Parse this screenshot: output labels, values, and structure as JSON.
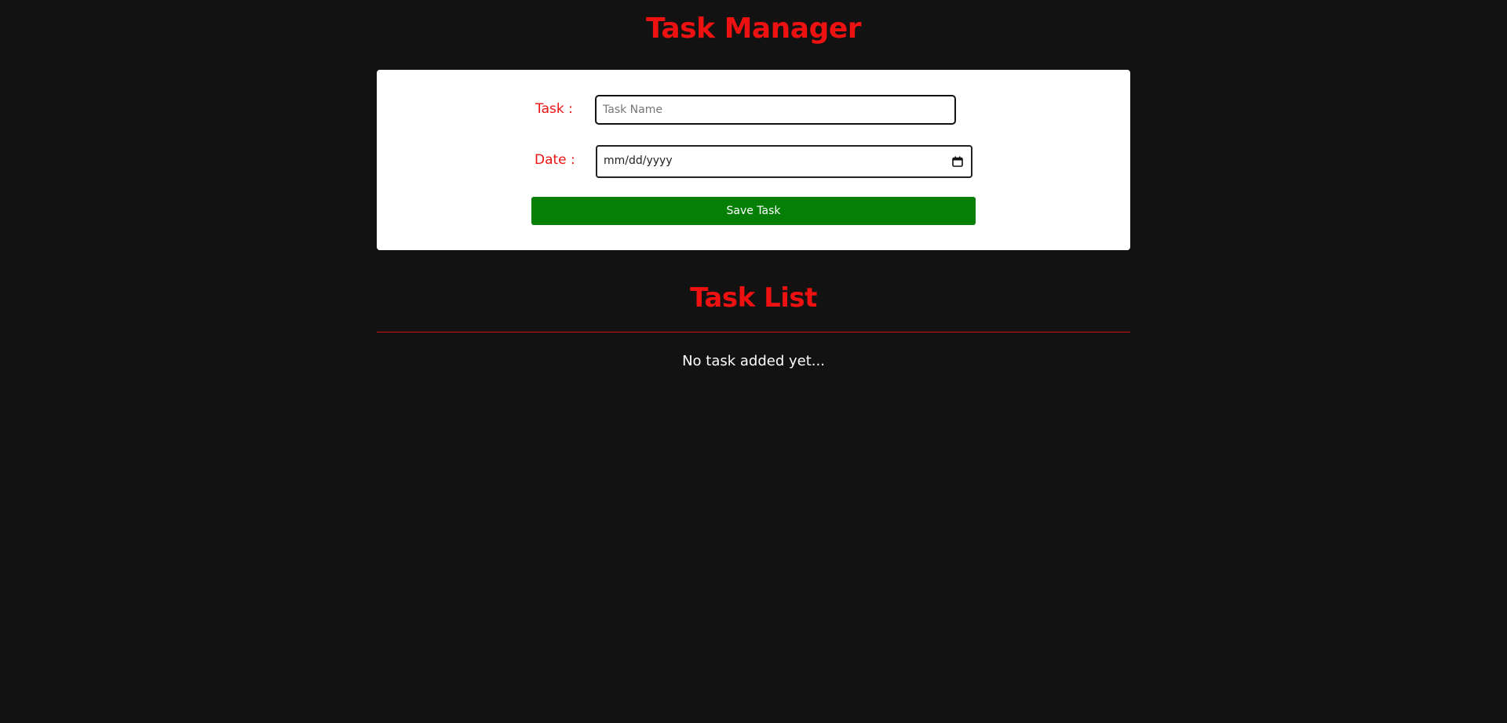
{
  "header": {
    "title": "Task Manager"
  },
  "form": {
    "task_label": "Task :",
    "task_placeholder": "Task Name",
    "task_value": "",
    "date_label": "Date :",
    "date_placeholder": "mm/dd/yyyy",
    "calendar_icon": "calendar-icon",
    "save_label": "Save Task"
  },
  "list": {
    "title": "Task List",
    "empty_message": "No task added yet..."
  },
  "colors": {
    "background": "#121212",
    "accent": "#ee1111",
    "card": "#ffffff",
    "button": "#067f06",
    "text_light": "#ffffff"
  }
}
